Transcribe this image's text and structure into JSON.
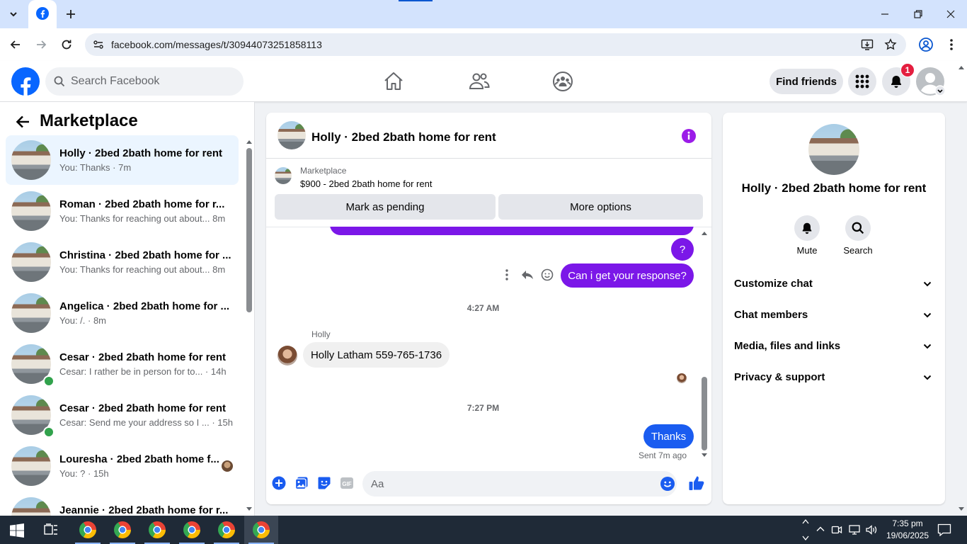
{
  "browser": {
    "url": "facebook.com/messages/t/30944073251858113",
    "colors": {
      "tabstrip": "#d3e3fd",
      "omnibox": "#e9eef6"
    }
  },
  "header": {
    "search_placeholder": "Search Facebook",
    "find_friends_label": "Find friends",
    "notification_count": "1",
    "colors": {
      "brand": "#0866ff",
      "badge": "#e41e3f"
    }
  },
  "sidebar": {
    "title": "Marketplace",
    "conversations": [
      {
        "name": "Holly · 2bed 2bath home for rent",
        "preview": "You: Thanks · 7m",
        "active": true
      },
      {
        "name": "Roman · 2bed 2bath home for r...",
        "preview": "You: Thanks for reaching out about... 8m"
      },
      {
        "name": "Christina · 2bed 2bath home for ...",
        "preview": "You: Thanks for reaching out about... 8m"
      },
      {
        "name": "Angelica · 2bed 2bath home for ...",
        "preview": "You: /. · 8m"
      },
      {
        "name": "Cesar · 2bed 2bath home for rent",
        "preview": "Cesar: I rather be in person for to...  · 14h",
        "online": true
      },
      {
        "name": "Cesar · 2bed 2bath home for rent",
        "preview": "Cesar: Send me your address so I ...  · 15h",
        "online": true
      },
      {
        "name": "Louresha · 2bed 2bath home f...",
        "preview": "You: ? · 15h"
      },
      {
        "name": "Jeannie · 2bed 2bath home for r...",
        "preview": ""
      }
    ]
  },
  "chat": {
    "title": "Holly · 2bed 2bath home for rent",
    "marketplace_label": "Marketplace",
    "listing": "$900 - 2bed 2bath home for rent",
    "mark_pending_label": "Mark as pending",
    "more_options_label": "More options",
    "messages": {
      "out_question": "?",
      "out_response": "Can i get your response?",
      "time_1": "4:27 AM",
      "sender_name": "Holly",
      "in_message": "Holly Latham 559-765-1736",
      "time_2": "7:27 PM",
      "out_thanks": "Thanks",
      "sent_status": "Sent 7m ago"
    },
    "composer_placeholder": "Aa",
    "colors": {
      "outgoing_a": "#7b17e8",
      "outgoing_b": "#1a5cf0",
      "accent": "#9b1ce8"
    }
  },
  "info": {
    "name": "Holly · 2bed 2bath home for rent",
    "mute_label": "Mute",
    "search_label": "Search",
    "sections": [
      "Customize chat",
      "Chat members",
      "Media, files and links",
      "Privacy & support"
    ]
  },
  "taskbar": {
    "time": "7:35 pm",
    "date": "19/06/2025"
  }
}
